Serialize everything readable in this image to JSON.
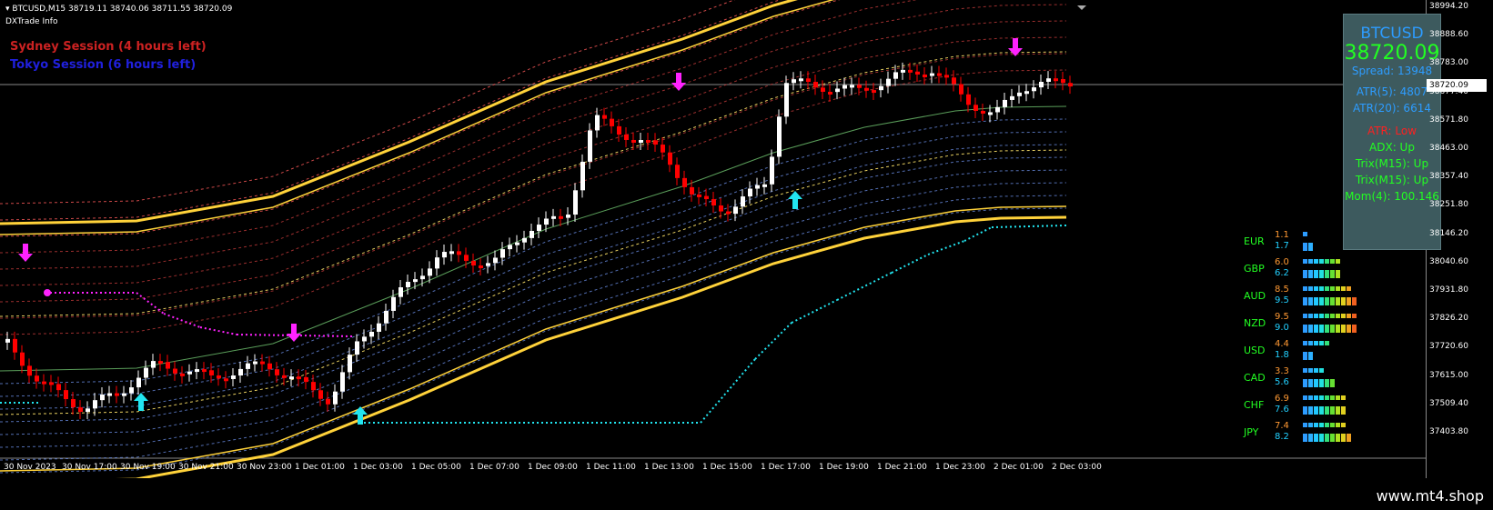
{
  "header": {
    "symbol_line": "BTCUSD,M15  38719.11 38740.06 38711.55 38720.09",
    "indicator": "DXTrade Info"
  },
  "sessions": [
    {
      "text": "Sydney Session (4 hours left)",
      "color": "#cc2222"
    },
    {
      "text": "Tokyo Session (6 hours left)",
      "color": "#2020dd"
    }
  ],
  "panel": {
    "symbol": "BTCUSD",
    "price": "38720.09",
    "spread": "Spread: 13948",
    "atr5": "ATR(5): 4807",
    "atr20": "ATR(20): 6614",
    "atr_state": "ATR: Low",
    "adx": "ADX: Up",
    "trix1": "Trix(M15): Up",
    "trix2": "Trix(M15): Up",
    "mom": "Mom(4): 100.146"
  },
  "price_axis": [
    "38994.20",
    "38888.60",
    "38783.00",
    "38677.40",
    "38571.80",
    "38463.00",
    "38357.40",
    "38251.80",
    "38146.20",
    "38040.60",
    "37931.80",
    "37826.20",
    "37720.60",
    "37615.00",
    "37509.40",
    "37403.80"
  ],
  "current_price": "38720.09",
  "time_axis": [
    "30 Nov 2023",
    "30 Nov 17:00",
    "30 Nov 19:00",
    "30 Nov 21:00",
    "30 Nov 23:00",
    "1 Dec 01:00",
    "1 Dec 03:00",
    "1 Dec 05:00",
    "1 Dec 07:00",
    "1 Dec 09:00",
    "1 Dec 11:00",
    "1 Dec 13:00",
    "1 Dec 15:00",
    "1 Dec 17:00",
    "1 Dec 19:00",
    "1 Dec 21:00",
    "1 Dec 23:00",
    "2 Dec 01:00",
    "2 Dec 03:00"
  ],
  "strength": [
    {
      "cur": "EUR",
      "a": "1.1",
      "b": "1.7",
      "va": 1.1,
      "vb": 1.7
    },
    {
      "cur": "GBP",
      "a": "6.0",
      "b": "6.2",
      "va": 6.0,
      "vb": 6.2
    },
    {
      "cur": "AUD",
      "a": "8.5",
      "b": "9.5",
      "va": 8.5,
      "vb": 9.5
    },
    {
      "cur": "NZD",
      "a": "9.5",
      "b": "9.0",
      "va": 9.5,
      "vb": 9.0
    },
    {
      "cur": "USD",
      "a": "4.4",
      "b": "1.8",
      "va": 4.4,
      "vb": 1.8
    },
    {
      "cur": "CAD",
      "a": "3.3",
      "b": "5.6",
      "va": 3.3,
      "vb": 5.6
    },
    {
      "cur": "CHF",
      "a": "6.9",
      "b": "7.6",
      "va": 6.9,
      "vb": 7.6
    },
    {
      "cur": "JPY",
      "a": "7.4",
      "b": "8.2",
      "va": 7.4,
      "vb": 8.2
    }
  ],
  "watermark": "www.mt4.shop",
  "colors": {
    "bull": "#ffffff",
    "bear": "#ff0000",
    "band": "#ffd23a",
    "up_arrow": "#22e5f0",
    "down_arrow": "#ff22ff"
  }
}
